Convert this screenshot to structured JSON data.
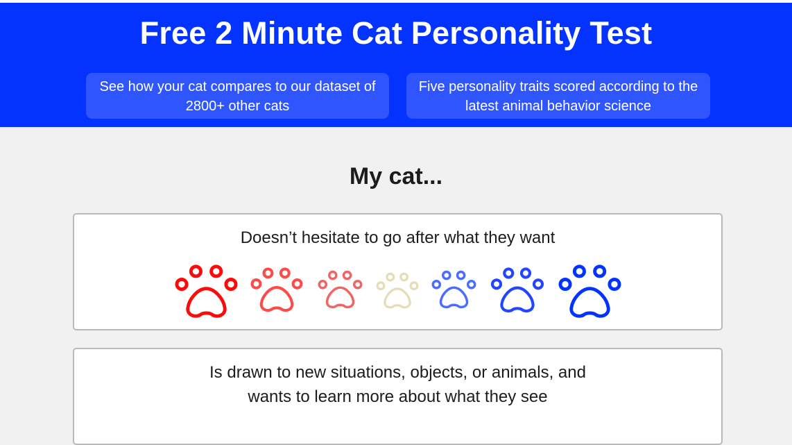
{
  "hero": {
    "title": "Free 2 Minute Cat Personality Test",
    "pill_left": "See how your cat compares to our dataset of 2800+ other cats",
    "pill_right": "Five personality traits scored according to the latest animal behavior science",
    "background_color": "#0433ff"
  },
  "section": {
    "title": "My cat..."
  },
  "questions": [
    {
      "text": "Doesn’t hesitate to go after what they want",
      "scale": [
        {
          "icon": "paw-icon",
          "color": "#ff0a0a"
        },
        {
          "icon": "paw-icon",
          "color": "#ff4a4a"
        },
        {
          "icon": "paw-icon",
          "color": "#f26464"
        },
        {
          "icon": "paw-icon",
          "color": "#e6dcb8"
        },
        {
          "icon": "paw-icon",
          "color": "#4a6cff"
        },
        {
          "icon": "paw-icon",
          "color": "#2246ff"
        },
        {
          "icon": "paw-icon",
          "color": "#0433ff"
        }
      ]
    },
    {
      "text_line1": "Is drawn to new situations, objects, or animals, and",
      "text_line2": "wants to learn more about what they see"
    }
  ]
}
